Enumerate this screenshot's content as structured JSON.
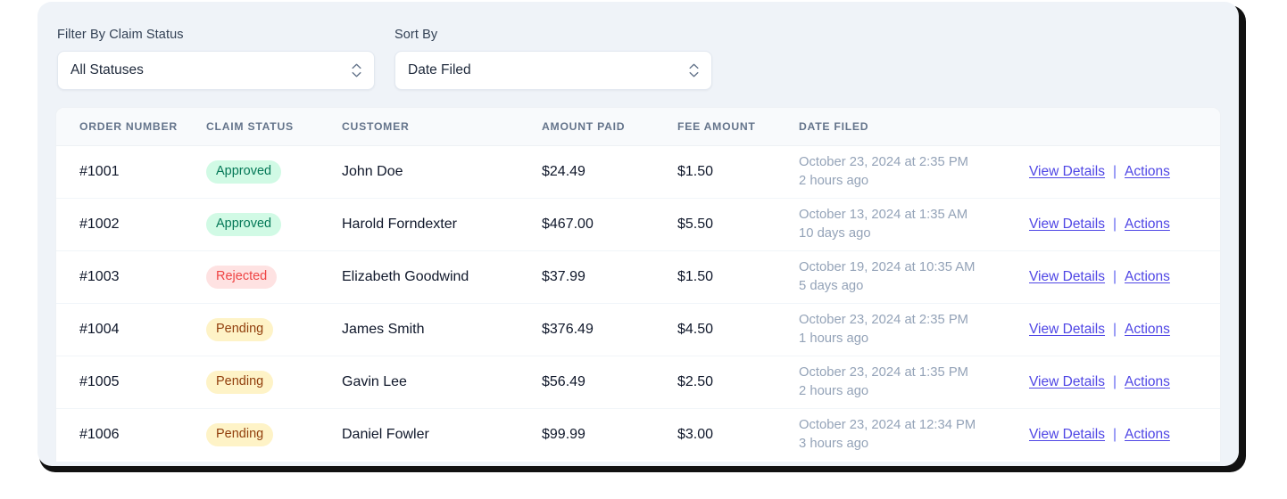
{
  "filters": {
    "status": {
      "label": "Filter By Claim Status",
      "value": "All Statuses",
      "icon": "chevron-updown-icon"
    },
    "sort": {
      "label": "Sort By",
      "value": "Date Filed",
      "icon": "chevron-updown-icon"
    }
  },
  "table": {
    "columns": [
      "ORDER NUMBER",
      "CLAIM STATUS",
      "CUSTOMER",
      "AMOUNT PAID",
      "FEE AMOUNT",
      "DATE FILED",
      ""
    ],
    "actions": {
      "view_details": "View Details",
      "separator": "|",
      "more": "Actions"
    },
    "rows": [
      {
        "order": "#1001",
        "status": "Approved",
        "status_kind": "approved",
        "customer": "John Doe",
        "amount_paid": "$24.49",
        "fee_amount": "$1.50",
        "date_filed": "October 23, 2024 at 2:35 PM",
        "date_relative": "2 hours ago"
      },
      {
        "order": "#1002",
        "status": "Approved",
        "status_kind": "approved",
        "customer": "Harold Forndexter",
        "amount_paid": "$467.00",
        "fee_amount": "$5.50",
        "date_filed": "October 13, 2024 at 1:35 AM",
        "date_relative": "10 days ago"
      },
      {
        "order": "#1003",
        "status": "Rejected",
        "status_kind": "rejected",
        "customer": "Elizabeth Goodwind",
        "amount_paid": "$37.99",
        "fee_amount": "$1.50",
        "date_filed": "October 19, 2024 at 10:35 AM",
        "date_relative": "5 days ago"
      },
      {
        "order": "#1004",
        "status": "Pending",
        "status_kind": "pending",
        "customer": "James Smith",
        "amount_paid": "$376.49",
        "fee_amount": "$4.50",
        "date_filed": "October 23, 2024 at 2:35 PM",
        "date_relative": "1 hours ago"
      },
      {
        "order": "#1005",
        "status": "Pending",
        "status_kind": "pending",
        "customer": "Gavin Lee",
        "amount_paid": "$56.49",
        "fee_amount": "$2.50",
        "date_filed": "October 23, 2024 at 1:35 PM",
        "date_relative": "2 hours ago"
      },
      {
        "order": "#1006",
        "status": "Pending",
        "status_kind": "pending",
        "customer": "Daniel Fowler",
        "amount_paid": "$99.99",
        "fee_amount": "$3.00",
        "date_filed": "October 23, 2024 at 12:34 PM",
        "date_relative": "3 hours ago"
      }
    ]
  },
  "colors": {
    "panel_bg": "#eff3f8",
    "link": "#4f46e5",
    "approved_bg": "#d1fae5",
    "approved_fg": "#047857",
    "rejected_bg": "#fee2e2",
    "rejected_fg": "#ef4444",
    "pending_bg": "#fef3c7",
    "pending_fg": "#92400e"
  }
}
